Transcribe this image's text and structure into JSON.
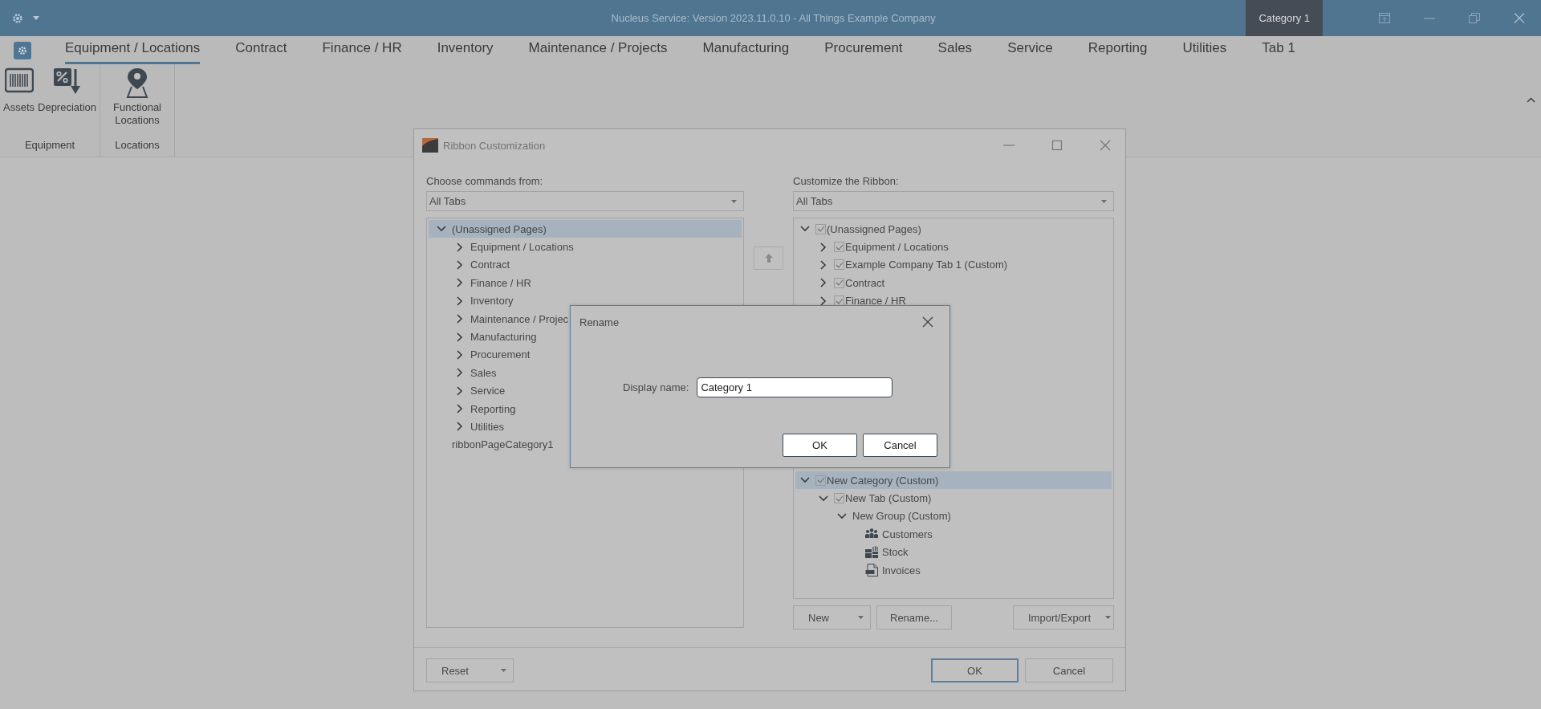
{
  "title_bar": {
    "title": "Nucleus Service: Version 2023.11.0.10 - All Things Example Company",
    "context_tab": "Category 1"
  },
  "ribbon": {
    "tabs": [
      {
        "label": "Equipment / Locations",
        "selected": true
      },
      {
        "label": "Contract",
        "selected": false
      },
      {
        "label": "Finance / HR",
        "selected": false
      },
      {
        "label": "Inventory",
        "selected": false
      },
      {
        "label": "Maintenance / Projects",
        "selected": false
      },
      {
        "label": "Manufacturing",
        "selected": false
      },
      {
        "label": "Procurement",
        "selected": false
      },
      {
        "label": "Sales",
        "selected": false
      },
      {
        "label": "Service",
        "selected": false
      },
      {
        "label": "Reporting",
        "selected": false
      },
      {
        "label": "Utilities",
        "selected": false
      },
      {
        "label": "Tab 1",
        "selected": false
      }
    ],
    "groups": [
      {
        "label": "Equipment",
        "commands": [
          "Assets",
          "Depreciation"
        ]
      },
      {
        "label": "Locations",
        "commands": [
          "Functional Locations"
        ]
      }
    ]
  },
  "customize_dialog": {
    "title": "Ribbon Customization",
    "left": {
      "label": "Choose commands from:",
      "dropdown": "All Tabs",
      "tree": [
        {
          "label": "(Unassigned Pages)",
          "expanded": true,
          "selected": true,
          "children": [
            {
              "label": "Equipment / Locations",
              "expanded": false,
              "selected": false
            },
            {
              "label": "Contract",
              "expanded": false,
              "selected": false
            },
            {
              "label": "Finance / HR",
              "expanded": false,
              "selected": false
            },
            {
              "label": "Inventory",
              "expanded": false,
              "selected": false
            },
            {
              "label": "Maintenance / Projec",
              "expanded": false,
              "selected": false
            },
            {
              "label": "Manufacturing",
              "expanded": false,
              "selected": false
            },
            {
              "label": "Procurement",
              "expanded": false,
              "selected": false
            },
            {
              "label": "Sales",
              "expanded": false,
              "selected": false
            },
            {
              "label": "Service",
              "expanded": false,
              "selected": false
            },
            {
              "label": "Reporting",
              "expanded": false,
              "selected": false
            },
            {
              "label": "Utilities",
              "expanded": false,
              "selected": false
            }
          ]
        },
        {
          "label": "ribbonPageCategory1",
          "selected": false
        }
      ]
    },
    "right": {
      "label": "Customize the Ribbon:",
      "dropdown": "All Tabs",
      "tree": [
        {
          "label": "(Unassigned Pages)",
          "kind": "node",
          "expanded": true,
          "checked": true,
          "selected": false,
          "children": [
            {
              "label": "Equipment / Locations",
              "kind": "node",
              "expanded": false,
              "checked": true,
              "selected": false
            },
            {
              "label": "Example Company Tab 1 (Custom)",
              "kind": "node",
              "expanded": false,
              "checked": true,
              "selected": false
            },
            {
              "label": "Contract",
              "kind": "node",
              "expanded": false,
              "checked": true,
              "selected": false
            },
            {
              "label": "Finance / HR",
              "kind": "node",
              "expanded": false,
              "checked": true,
              "selected": false
            }
          ]
        },
        {
          "label": "New Category (Custom)",
          "kind": "node",
          "expanded": true,
          "checked": true,
          "selected": true,
          "children": [
            {
              "label": "New Tab (Custom)",
              "kind": "node",
              "expanded": true,
              "checked": true,
              "selected": false,
              "children": [
                {
                  "label": "New Group (Custom)",
                  "kind": "group",
                  "expanded": true,
                  "selected": false,
                  "children": [
                    {
                      "label": "Customers",
                      "kind": "command",
                      "selected": false
                    },
                    {
                      "label": "Stock",
                      "kind": "command",
                      "selected": false
                    },
                    {
                      "label": "Invoices",
                      "kind": "command",
                      "selected": false
                    }
                  ]
                }
              ]
            }
          ]
        }
      ],
      "buttons": [
        {
          "label": "New",
          "kind": "split"
        },
        {
          "label": "Rename...",
          "kind": "plain"
        },
        {
          "label": "Import/Export",
          "kind": "split"
        }
      ]
    },
    "reset": {
      "label": "Reset",
      "kind": "split"
    },
    "buttons": [
      {
        "label": "OK",
        "default": true
      },
      {
        "label": "Cancel",
        "default": false
      }
    ]
  },
  "rename_dialog": {
    "title": "Rename",
    "field_label": "Display name:",
    "value": "Category 1",
    "buttons": [
      "OK",
      "Cancel"
    ]
  }
}
